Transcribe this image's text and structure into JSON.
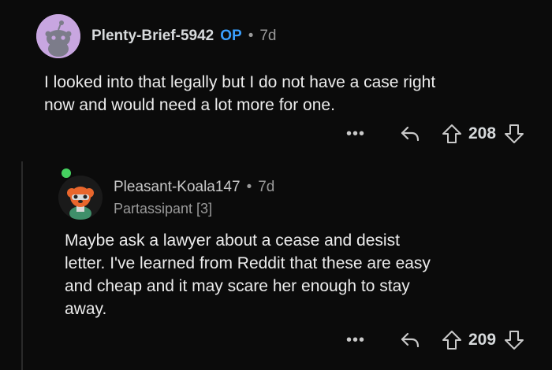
{
  "comments": [
    {
      "username": "Plenty-Brief-5942",
      "op_badge": "OP",
      "separator": "•",
      "age": "7d",
      "body": "I looked into that legally but I do not have a case right\nnow and would need a lot more for one.",
      "more": "•••",
      "score": "208",
      "avatar_icon": "snoo-avatar-icon",
      "colors": {
        "avatar_bg": "#c8a6e0",
        "op": "#3aa0ff"
      }
    },
    {
      "username": "Pleasant-Koala147",
      "separator": "•",
      "age": "7d",
      "flair": "Partassipant [3]",
      "body": "Maybe ask a lawyer about a cease and desist\nletter. I've learned from Reddit that these are easy\nand cheap and it may scare her enough to stay\naway.",
      "more": "•••",
      "score": "209",
      "avatar_icon": "koala-avatar-icon",
      "colors": {
        "online_dot": "#46d160"
      }
    }
  ]
}
